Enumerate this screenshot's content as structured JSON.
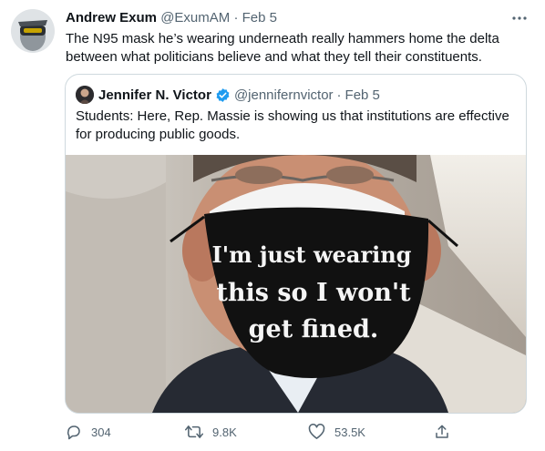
{
  "tweet": {
    "author_name": "Andrew Exum",
    "author_handle": "@ExumAM",
    "separator": "·",
    "date": "Feb 5",
    "text": "The N95 mask he’s wearing underneath really hammers home the delta between what politicians believe and what they tell their constituents.",
    "more_icon": "more-horizontal-icon"
  },
  "quote": {
    "author_name": "Jennifer N. Victor",
    "verified_icon": "verified-badge-icon",
    "author_handle": "@jennifernvictor",
    "separator": "·",
    "date": "Feb 5",
    "text": "Students: Here, Rep. Massie is showing us that institutions are effective for producing public goods.",
    "image_description_icon": "photo",
    "mask_text": [
      "I'm just wearing",
      "this so I won't",
      "get fined."
    ]
  },
  "actions": {
    "reply": {
      "icon": "reply-icon",
      "count": "304"
    },
    "retweet": {
      "icon": "retweet-icon",
      "count": "9.8K"
    },
    "like": {
      "icon": "like-icon",
      "count": "53.5K"
    },
    "share": {
      "icon": "share-icon"
    }
  },
  "colors": {
    "text": "#0f1419",
    "muted": "#536471",
    "border": "#cfd9de",
    "verified": "#1d9bf0"
  }
}
